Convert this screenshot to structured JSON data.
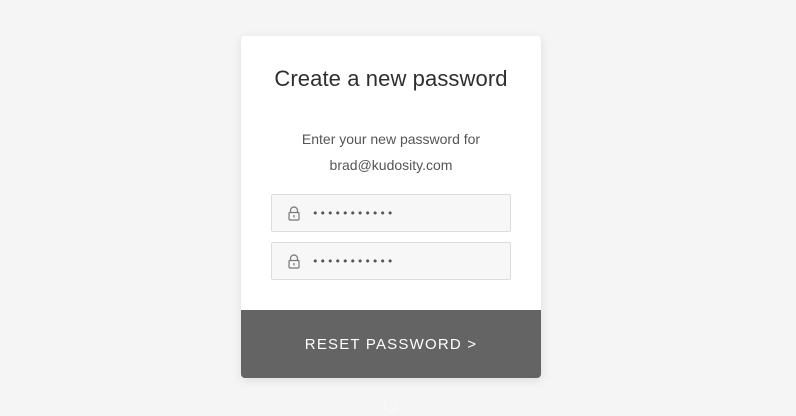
{
  "card": {
    "title": "Create a new password",
    "subtitle_line1": "Enter your new password for",
    "subtitle_line2": "brad@kudosity.com"
  },
  "fields": {
    "new_password": {
      "value": "•••••••••••",
      "icon": "lock-icon"
    },
    "confirm_password": {
      "value": "•••••••••••",
      "icon": "lock-icon"
    }
  },
  "actions": {
    "reset_label": "RESET PASSWORD >"
  },
  "colors": {
    "background": "#f5f5f5",
    "card": "#ffffff",
    "button": "#646464",
    "title": "#2f2f2f"
  }
}
